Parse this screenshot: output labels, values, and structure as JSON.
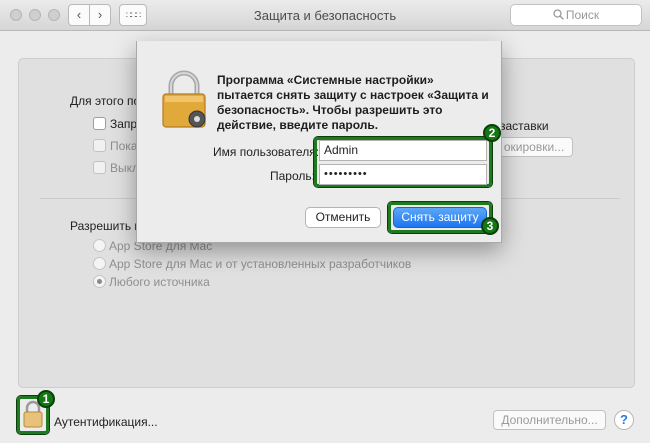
{
  "window": {
    "title": "Защита и безопасность"
  },
  "toolbar": {
    "back": "‹",
    "forward": "›",
    "grid": "∷∷∷"
  },
  "search": {
    "placeholder": "Поиск",
    "icon": "magnifier-icon"
  },
  "panel": {
    "section1_label": "Для этого по",
    "checks": [
      "Запра",
      "Показ",
      "Выкл"
    ],
    "right_text": "заставки",
    "right_button": "окировки...",
    "section2_label": "Разрешить и",
    "radios": [
      {
        "label": "App Store для Mac",
        "selected": false
      },
      {
        "label": "App Store для Mac и от установленных разработчиков",
        "selected": false
      },
      {
        "label": "Любого источника",
        "selected": true
      }
    ]
  },
  "bottom": {
    "auth_label": "Аутентификация...",
    "advanced_button": "Дополнительно...",
    "help_label": "?"
  },
  "dialog": {
    "message": "Программа «Системные настройки» пытается снять защиту с настроек «Защита и безопасность». Чтобы разрешить это действие, введите пароль.",
    "username_label": "Имя пользователя:",
    "username_value": "Admin",
    "password_label": "Пароль:",
    "password_value": "•••••••••",
    "cancel_label": "Отменить",
    "confirm_label": "Снять защиту"
  },
  "steps": [
    "1",
    "2",
    "3"
  ],
  "colors": {
    "highlight": "#1f7a1f",
    "primary_button": "#1d74ef",
    "lock_gold": "#e0a93a"
  }
}
